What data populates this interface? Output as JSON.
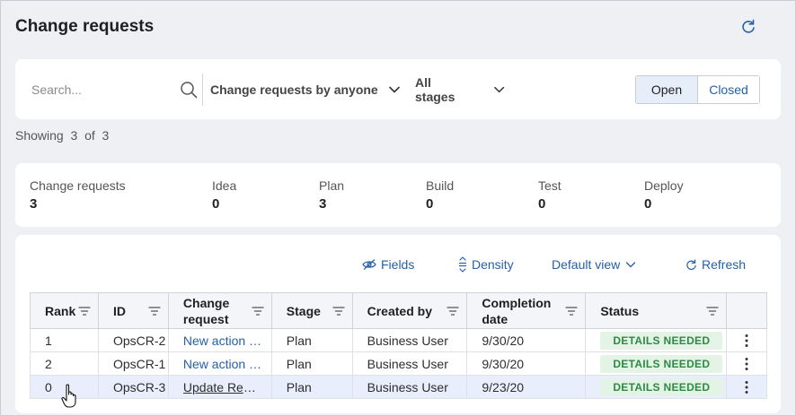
{
  "header": {
    "title": "Change requests",
    "refresh_icon": "refresh-icon"
  },
  "filters": {
    "search_placeholder": "Search...",
    "search_value": "",
    "owner_filter": "Change requests by anyone",
    "stage_filter": "All stages",
    "toggle": {
      "open_label": "Open",
      "closed_label": "Closed",
      "selected": "Open"
    }
  },
  "showing": {
    "prefix": "Showing",
    "count": "3",
    "of": "of",
    "total": "3"
  },
  "stats": [
    {
      "label": "Change requests",
      "value": "3"
    },
    {
      "label": "Idea",
      "value": "0"
    },
    {
      "label": "Plan",
      "value": "3"
    },
    {
      "label": "Build",
      "value": "0"
    },
    {
      "label": "Test",
      "value": "0"
    },
    {
      "label": "Deploy",
      "value": "0"
    }
  ],
  "toolbar": {
    "fields_label": "Fields",
    "density_label": "Density",
    "view_label": "Default view",
    "refresh_label": "Refresh"
  },
  "table": {
    "columns": [
      "Rank",
      "ID",
      "Change request",
      "Stage",
      "Created by",
      "Completion date",
      "Status"
    ],
    "rows": [
      {
        "rank": "1",
        "id": "OpsCR-2",
        "change_request": "New action …",
        "stage": "Plan",
        "created_by": "Business User",
        "completion_date": "9/30/20",
        "status": "DETAILS NEEDED"
      },
      {
        "rank": "2",
        "id": "OpsCR-1",
        "change_request": "New action …",
        "stage": "Plan",
        "created_by": "Business User",
        "completion_date": "9/30/20",
        "status": "DETAILS NEEDED"
      },
      {
        "rank": "0",
        "id": "OpsCR-3",
        "change_request": "Update Rew…",
        "stage": "Plan",
        "created_by": "Business User",
        "completion_date": "9/23/20",
        "status": "DETAILS NEEDED"
      }
    ]
  },
  "colors": {
    "accent": "#2560a8",
    "status_bg": "#e3f3e6",
    "status_text": "#2f8a43",
    "hover_row": "#e8eefb"
  }
}
